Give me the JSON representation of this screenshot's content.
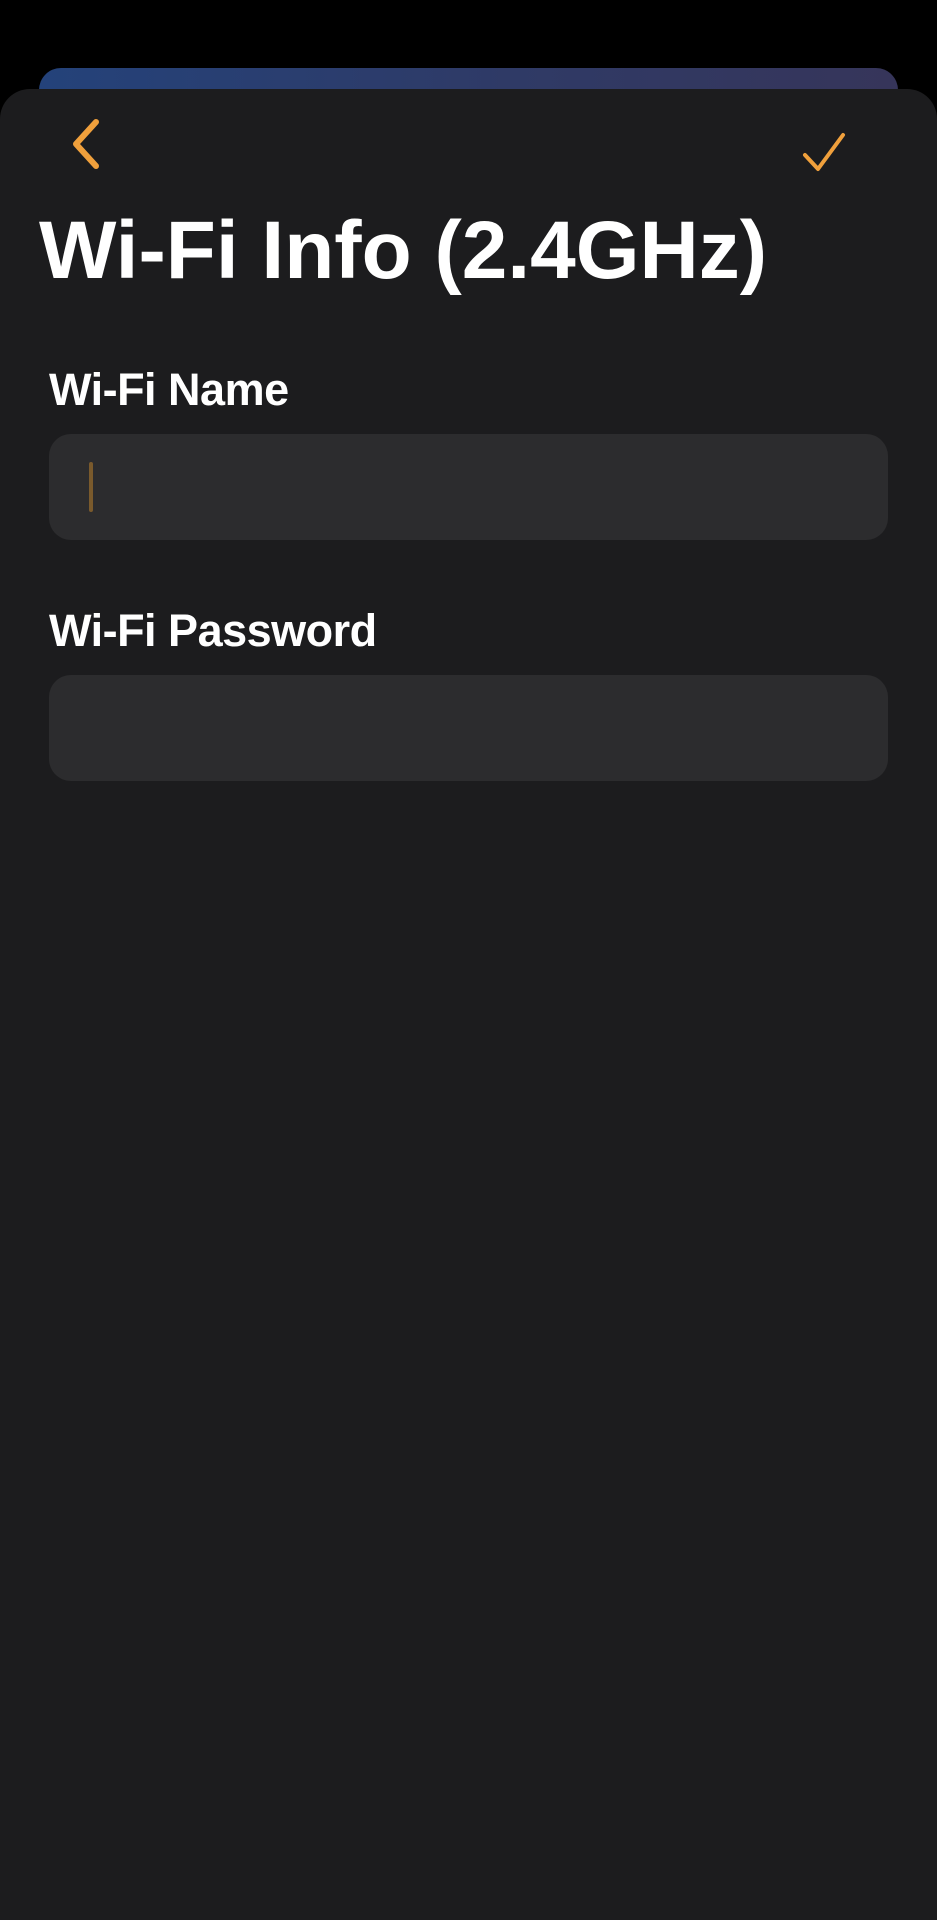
{
  "header": {
    "back_icon": "chevron-left-icon",
    "confirm_icon": "checkmark-icon",
    "accent_color": "#f0a03c"
  },
  "title": "Wi-Fi Info (2.4GHz)",
  "form": {
    "wifi_name": {
      "label": "Wi-Fi Name",
      "value": "",
      "placeholder": ""
    },
    "wifi_password": {
      "label": "Wi-Fi Password",
      "value": "",
      "placeholder": ""
    }
  },
  "colors": {
    "background": "#1c1c1e",
    "field_background": "#2c2c2e",
    "text": "#ffffff"
  }
}
